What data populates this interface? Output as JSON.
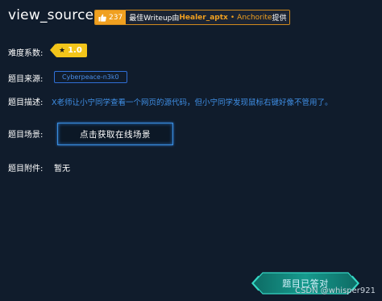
{
  "challenge": {
    "title": "view_source",
    "writeup": {
      "likes": "237",
      "prefix": "最佳Writeup由",
      "author": "Healer_aptx",
      "team": "Anchorite",
      "suffix": "提供"
    },
    "difficulty": {
      "label": "难度系数:",
      "value": "1.0"
    },
    "source": {
      "label": "题目来源:",
      "value": "Cyberpeace-n3k0"
    },
    "description": {
      "label": "题目描述:",
      "value": "X老师让小宁同学查看一个网页的源代码，但小宁同学发现鼠标右键好像不管用了。"
    },
    "scene": {
      "label": "题目场景:",
      "button": "点击获取在线场景"
    },
    "attachment": {
      "label": "题目附件:",
      "value": "暂无"
    },
    "status": "题目已答对"
  },
  "watermark": "CSDN @whisper921",
  "colors": {
    "background": "#101c2c",
    "accent_orange": "#f0a020",
    "difficulty_yellow": "#f3c51a",
    "link_blue": "#3f8fe6",
    "answered_teal": "#1aa89a"
  },
  "icons": [
    "thumbs-up-icon",
    "star-icon"
  ]
}
